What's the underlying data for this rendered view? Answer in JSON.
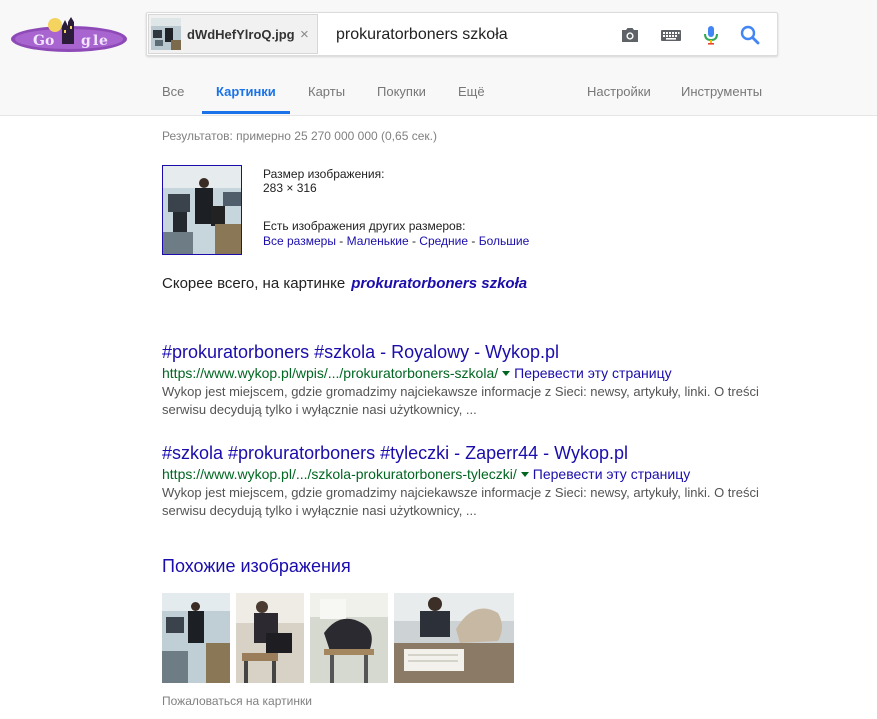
{
  "search": {
    "image_chip": {
      "filename": "dWdHefYlroQ.jpg",
      "close_symbol": "×"
    },
    "query": "prokuratorboners szkoła",
    "icons": [
      "camera-icon",
      "keyboard-icon",
      "microphone-icon",
      "search-icon"
    ]
  },
  "tabs": [
    {
      "label": "Все",
      "active": false
    },
    {
      "label": "Картинки",
      "active": true
    },
    {
      "label": "Карты",
      "active": false
    },
    {
      "label": "Покупки",
      "active": false
    },
    {
      "label": "Ещё",
      "active": false
    }
  ],
  "tools": {
    "settings": "Настройки",
    "instruments": "Инструменты"
  },
  "stats": "Результатов: примерно 25 270 000 000 (0,65 сек.)",
  "image_info": {
    "size_label": "Размер изображения:",
    "size_value": "283 × 316",
    "other_sizes_label": "Есть изображения других размеров:",
    "size_links": [
      "Все размеры",
      "Маленькие",
      "Средние",
      "Большие"
    ],
    "separator": " - "
  },
  "best_guess": {
    "prefix": "Скорее всего, на картинке",
    "link": "prokuratorboners szkoła"
  },
  "results": [
    {
      "title": "#prokuratorboners #szkola - Royalowy - Wykop.pl",
      "url": "https://www.wykop.pl/wpis/.../prokuratorboners-szkola/",
      "translate": "Перевести эту страницу",
      "snippet_line1": "Wykop jest miejscem, gdzie gromadzimy najciekawsze informacje z Sieci: newsy, artykuły, linki. O treści",
      "snippet_line2": "serwisu decydują tylko i wyłącznie nasi użytkownicy, ..."
    },
    {
      "title": "#szkola #prokuratorboners #tyleczki - Zaperr44 - Wykop.pl",
      "url": "https://www.wykop.pl/.../szkola-prokuratorboners-tyleczki/",
      "translate": "Перевести эту страницу",
      "snippet_line1": "Wykop jest miejscem, gdzie gromadzimy najciekawsze informacje z Sieci: newsy, artykuły, linki. O treści",
      "snippet_line2": "serwisu decydują tylko i wyłącznie nasi użytkownicy, ..."
    }
  ],
  "similar": {
    "heading": "Похожие изображения",
    "images": [
      "classroom photo 1",
      "classroom photo 2",
      "classroom photo 3",
      "classroom photo 4"
    ]
  },
  "report_link": "Пожаловаться на картинки",
  "colors": {
    "link_blue": "#1a0dab",
    "tab_active": "#1a73e8",
    "url_green": "#006621",
    "snippet_gray": "#545454",
    "logo_purple": "#8e4ab6"
  }
}
